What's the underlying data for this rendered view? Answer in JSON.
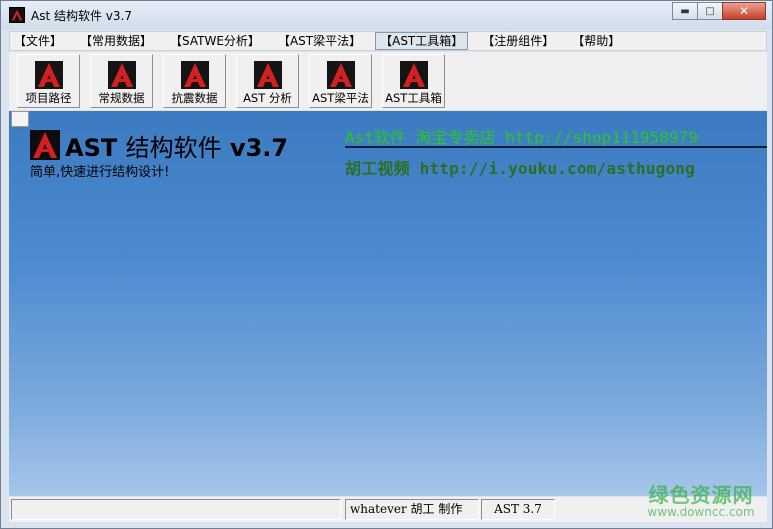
{
  "window": {
    "title": "Ast 结构软件 v3.7"
  },
  "window_controls": {
    "minimize": "▬",
    "maximize": "□",
    "close": "✕"
  },
  "menu": [
    "【文件】",
    "【常用数据】",
    "【SATWE分析】",
    "【AST梁平法】",
    "【AST工具箱】",
    "【注册组件】",
    "【帮助】"
  ],
  "toolbar": [
    "项目路径",
    "常规数据",
    "抗震数据",
    "AST 分析",
    "AST梁平法",
    "AST工具箱"
  ],
  "banner": {
    "brand_latin": "AST",
    "brand_cn": "结构软件",
    "brand_version": "v3.7",
    "tagline": "简单,快速进行结构设计!",
    "shop": "Ast软件 淘宝专卖店 http://shop111958979",
    "video": "胡工视频 http://i.youku.com/asthugong"
  },
  "status": {
    "cell_empty": "",
    "author": "whatever 胡工 制作",
    "version": "AST 3.7"
  },
  "watermark": {
    "main": "绿色资源网",
    "sub": "www.downcc.com"
  },
  "colors": {
    "accent_red": "#d42020",
    "shop_text": "#2bc42b",
    "video_text": "#2b6f22",
    "canvas_blue": "#3c7bc1"
  },
  "icons": {
    "app": "ast-logo-icon",
    "tools": "ast-logo-icon"
  }
}
